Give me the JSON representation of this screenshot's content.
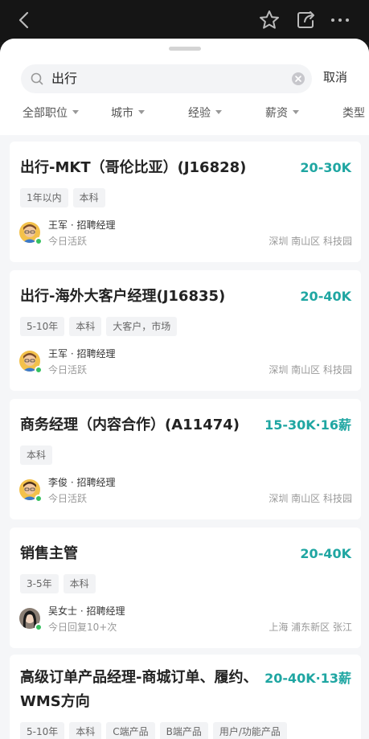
{
  "topbar": {
    "icons": [
      "back-arrow-icon",
      "star-icon",
      "share-icon",
      "more-icon"
    ]
  },
  "search": {
    "value": "出行",
    "cancel_label": "取消"
  },
  "filters": [
    "全部职位",
    "城市",
    "经验",
    "薪资",
    "类型"
  ],
  "jobs": [
    {
      "title": "出行-MKT（哥伦比亚）(J16828)",
      "salary": "20-30K",
      "tags": [
        "1年以内",
        "本科"
      ],
      "recruiter": "王军 · 招聘经理",
      "activity": "今日活跃",
      "location": "深圳 南山区 科技园"
    },
    {
      "title": "出行-海外大客户经理(J16835)",
      "salary": "20-40K",
      "tags": [
        "5-10年",
        "本科",
        "大客户，市场"
      ],
      "recruiter": "王军 · 招聘经理",
      "activity": "今日活跃",
      "location": "深圳 南山区 科技园"
    },
    {
      "title": "商务经理（内容合作）(A11474)",
      "salary": "15-30K·16薪",
      "tags": [
        "本科"
      ],
      "recruiter": "李俊 · 招聘经理",
      "activity": "今日活跃",
      "location": "深圳 南山区 科技园"
    },
    {
      "title": "销售主管",
      "salary": "20-40K",
      "tags": [
        "3-5年",
        "本科"
      ],
      "recruiter": "吴女士 · 招聘经理",
      "activity": "今日回复10+次",
      "location": "上海 浦东新区 张江"
    },
    {
      "title": "高级订单产品经理-商城订单、履约、WMS方向",
      "salary": "20-40K·13薪",
      "tags": [
        "5-10年",
        "本科",
        "C端产品",
        "B端产品",
        "用户/功能产品"
      ]
    }
  ],
  "colors": {
    "accent": "#1fa6a2",
    "online": "#36c160"
  }
}
